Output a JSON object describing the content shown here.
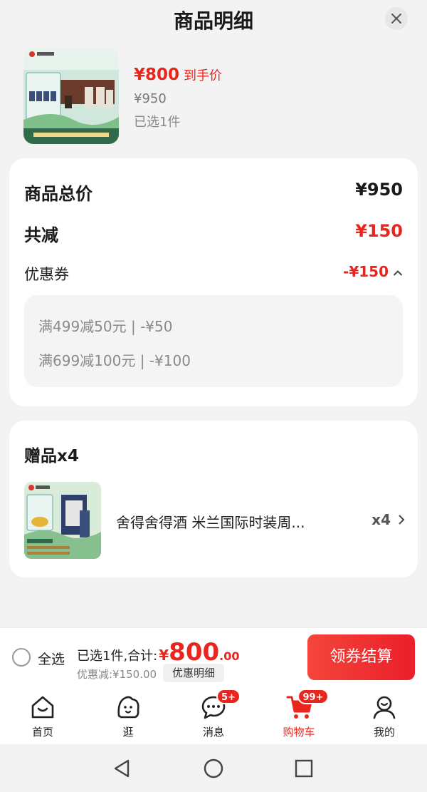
{
  "header": {
    "title": "商品明细"
  },
  "product": {
    "price_now": "¥800",
    "price_tag": "到手价",
    "price_orig": "¥950",
    "selected": "已选1件"
  },
  "summary": {
    "total_label": "商品总价",
    "total_value": "¥950",
    "reduce_label": "共减",
    "reduce_value": "¥150",
    "coupon_label": "优惠券",
    "coupon_value": "-¥150",
    "coupons": [
      "满499减50元 | -¥50",
      "满699减100元 | -¥100"
    ]
  },
  "gift": {
    "title": "赠品x4",
    "name": "舍得舍得酒 米兰国际时装周...",
    "qty": "x4"
  },
  "checkout": {
    "select_all": "全选",
    "sum_prefix": "已选1件,合计:",
    "currency": "¥",
    "sum_int": "800",
    "sum_dec": ".00",
    "discount": "优惠减:¥150.00",
    "detail_button": "优惠明细",
    "pay_button": "领券结算"
  },
  "tabbar": {
    "items": [
      {
        "label": "首页",
        "icon": "home-icon"
      },
      {
        "label": "逛",
        "icon": "browse-face-icon"
      },
      {
        "label": "消息",
        "icon": "message-icon",
        "badge": "5+"
      },
      {
        "label": "购物车",
        "icon": "cart-icon",
        "badge": "99+",
        "active": true
      },
      {
        "label": "我的",
        "icon": "profile-icon"
      }
    ]
  },
  "colors": {
    "accent": "#e8261d",
    "background": "#f3f3f3"
  }
}
